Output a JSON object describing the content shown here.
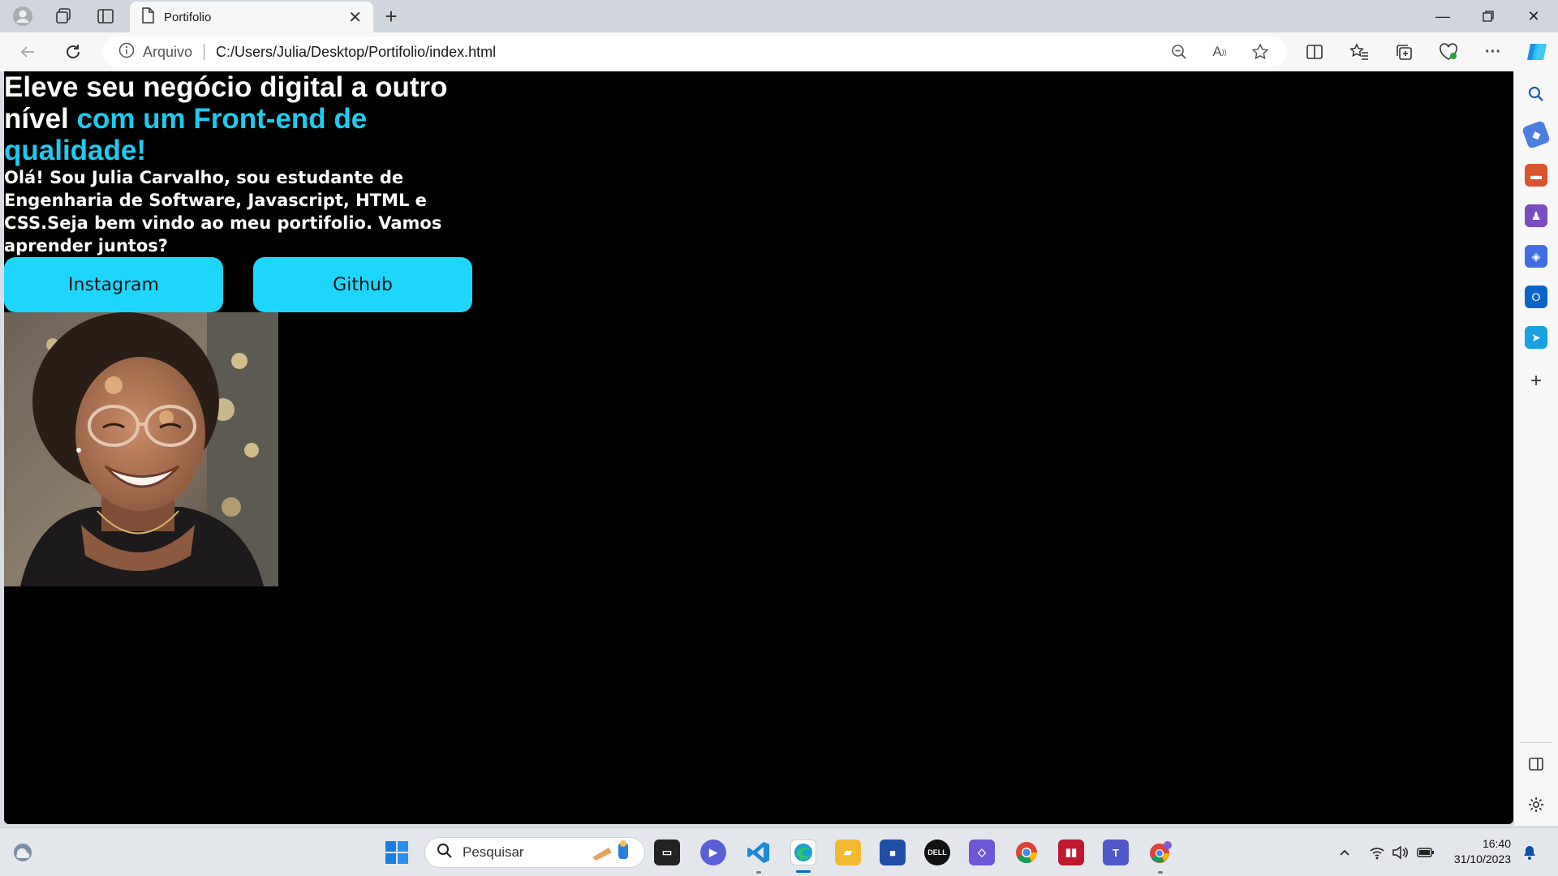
{
  "browser": {
    "tab": {
      "title": "Portifolio"
    },
    "address_bar": {
      "site_info": "Arquivo",
      "url": "C:/Users/Julia/Desktop/Portifolio/index.html"
    }
  },
  "page": {
    "hero": {
      "title_line1": "Eleve seu negócio digital a outro",
      "title_plain": "nível ",
      "title_accent": "com um Front-end de qualidade!",
      "intro": "Olá! Sou Julia Carvalho, sou estudante de Engenharia de Software, Javascript, HTML e CSS.Seja bem vindo ao meu portifolio. Vamos aprender juntos?"
    },
    "buttons": {
      "instagram": "Instagram",
      "github": "Github"
    }
  },
  "taskbar": {
    "search_placeholder": "Pesquisar",
    "clock_time": "16:40",
    "clock_date": "31/10/2023",
    "dell_label": "DELL"
  },
  "colors": {
    "accent": "#1ecbee",
    "button_bg": "#1ed6fb",
    "page_bg": "#000000"
  }
}
